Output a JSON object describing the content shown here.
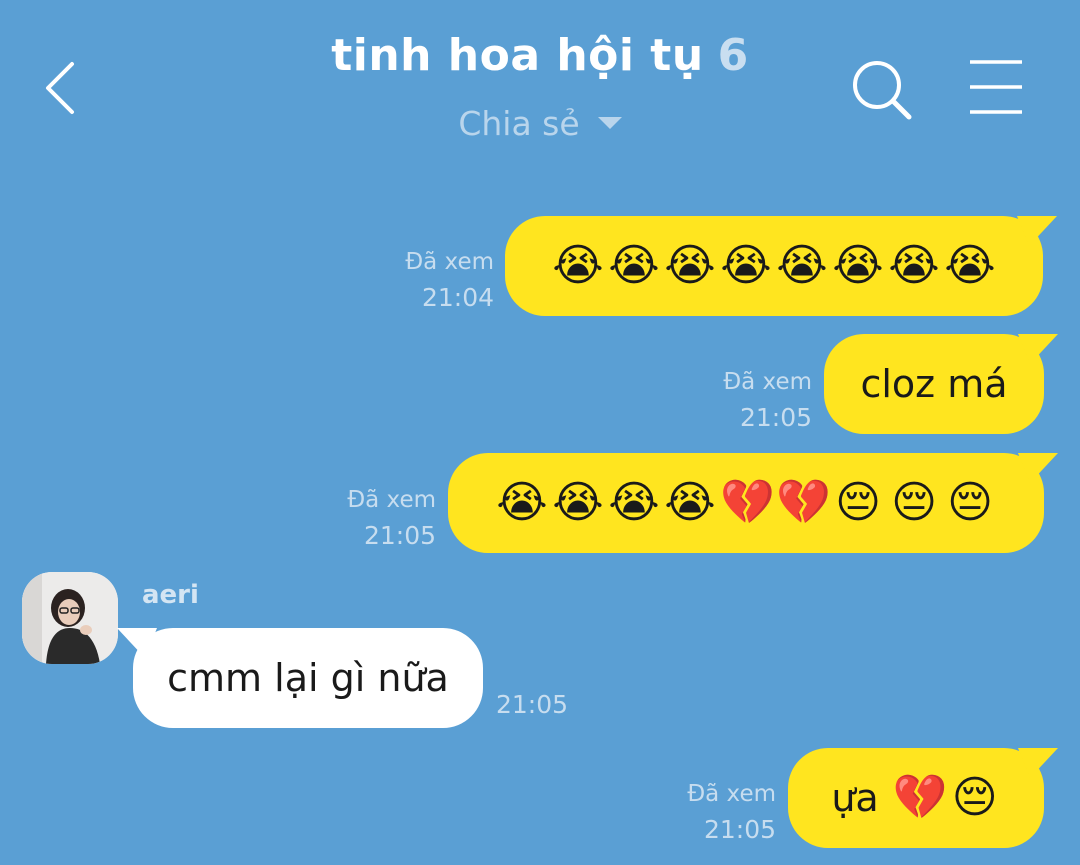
{
  "header": {
    "title": "tinh hoa hội tụ",
    "member_count": "6",
    "subtitle": "Chia sẻ",
    "back_icon": "chevron-left-icon",
    "search_icon": "search-icon",
    "menu_icon": "menu-icon"
  },
  "colors": {
    "background": "#5a9fd4",
    "my_bubble": "#ffe51f",
    "their_bubble": "#ffffff",
    "meta_text": "#c7ddef"
  },
  "messages": [
    {
      "sender": "me",
      "status": "Đã xem",
      "time": "21:04",
      "emojis": [
        "😭",
        "😭",
        "😭",
        "😭",
        "😭",
        "😭",
        "😭",
        "😭"
      ]
    },
    {
      "sender": "me",
      "status": "Đã xem",
      "time": "21:05",
      "text": "cloz má"
    },
    {
      "sender": "me",
      "status": "Đã xem",
      "time": "21:05",
      "emojis": [
        "😭",
        "😭",
        "😭",
        "😭",
        "💔",
        "💔",
        "😔",
        "😔",
        "😔"
      ]
    },
    {
      "sender": "aeri",
      "name": "aeri",
      "time": "21:05",
      "text": "cmm lại gì nữa"
    },
    {
      "sender": "me",
      "status": "Đã xem",
      "time": "21:05",
      "text": "ựa",
      "emojis": [
        "💔",
        "😔"
      ]
    }
  ]
}
